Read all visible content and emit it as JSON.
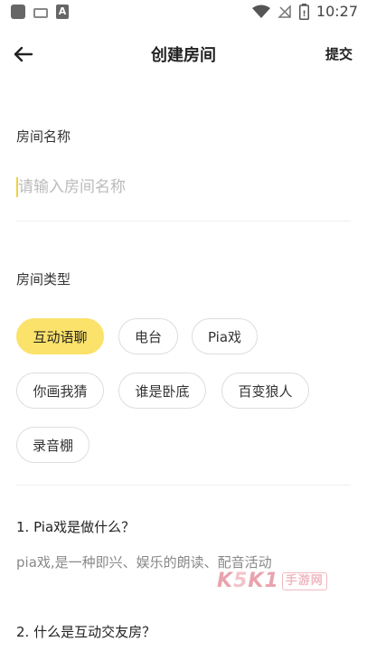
{
  "status_bar": {
    "time": "10:27",
    "left_icons": [
      "app-square-icon",
      "keyboard-icon",
      "a-badge-icon"
    ],
    "a_badge": "A",
    "right_icons": [
      "wifi-icon",
      "no-signal-icon",
      "battery-icon"
    ]
  },
  "header": {
    "back_icon": "arrow-left-icon",
    "title": "创建房间",
    "submit_label": "提交"
  },
  "room_name": {
    "label": "房间名称",
    "placeholder": "请输入房间名称",
    "value": ""
  },
  "room_type": {
    "label": "房间类型",
    "options": [
      "互动语聊",
      "电台",
      "Pia戏",
      "你画我猜",
      "谁是卧底",
      "百变狼人",
      "录音棚"
    ],
    "selected": "互动语聊",
    "selected_color": "#fbe26a"
  },
  "faq": [
    {
      "question": "1. Pia戏是做什么？",
      "answer": "pia戏,是一种即兴、娱乐的朗读、配音活动"
    },
    {
      "question": "2. 什么是互动交友房？",
      "answer": ""
    }
  ],
  "watermark": {
    "k": "K",
    "five": "5",
    "k2": "K",
    "one": "1",
    "box": "手游网"
  }
}
